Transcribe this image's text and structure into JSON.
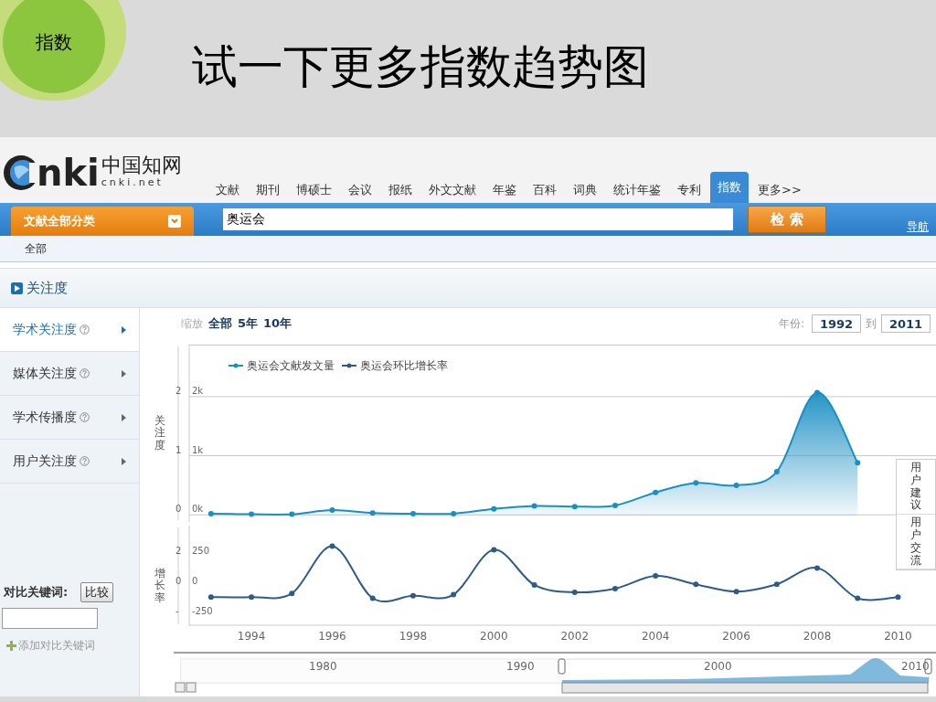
{
  "slide": {
    "badge": "指数",
    "title": "试一下更多指数趋势图"
  },
  "logo": {
    "letters": "nki",
    "chinese": "中国知网",
    "domain": "cnki.net"
  },
  "nav_tabs": [
    {
      "label": "文献",
      "selected": false
    },
    {
      "label": "期刊",
      "selected": false
    },
    {
      "label": "博硕士",
      "selected": false
    },
    {
      "label": "会议",
      "selected": false
    },
    {
      "label": "报纸",
      "selected": false
    },
    {
      "label": "外文文献",
      "selected": false
    },
    {
      "label": "年鉴",
      "selected": false
    },
    {
      "label": "百科",
      "selected": false
    },
    {
      "label": "词典",
      "selected": false
    },
    {
      "label": "统计年鉴",
      "selected": false
    },
    {
      "label": "专利",
      "selected": false
    },
    {
      "label": "指数",
      "selected": true
    },
    {
      "label": "更多>>",
      "selected": false
    }
  ],
  "search": {
    "category": "文献全部分类",
    "value": "奥运会",
    "button": "检 索",
    "nav_link": "导航",
    "scope": "全部"
  },
  "section_title": "关注度",
  "sidebar": {
    "items": [
      {
        "label": "学术关注度",
        "selected": true
      },
      {
        "label": "媒体关注度",
        "selected": false
      },
      {
        "label": "学术传播度",
        "selected": false
      },
      {
        "label": "用户关注度",
        "selected": false
      }
    ],
    "compare_label": "对比关键词:",
    "compare_button": "比较",
    "add_link": "添加对比关键词"
  },
  "toolbar": {
    "zoom_label": "缩放",
    "zoom_options": [
      "全部",
      "5年",
      "10年"
    ],
    "year_label": "年份:",
    "from": "1992",
    "to_label": "到",
    "to": "2011"
  },
  "charts": [
    {
      "marks": [
        "2",
        "1",
        "0"
      ],
      "chart_data": {
        "type": "area",
        "ylabel": "关注度",
        "ylim": [
          -120,
          2880
        ],
        "grid": true,
        "yticks": [
          {
            "value": 2000,
            "label": "2k"
          },
          {
            "value": 1000,
            "label": "1k"
          },
          {
            "value": 0,
            "label": "0k"
          }
        ],
        "series": [
          {
            "name": "奥运会文献发文量",
            "color": "#1a8fc4",
            "marker": true,
            "values": [
              20,
              10,
              10,
              80,
              30,
              20,
              20,
              100,
              150,
              140,
              160,
              380,
              540,
              500,
              730,
              2070,
              880,
              null
            ]
          }
        ]
      }
    },
    {
      "marks": [
        "2",
        "0",
        "-"
      ],
      "chart_data": {
        "type": "line",
        "x": [
          1993,
          1994,
          1995,
          1996,
          1997,
          1998,
          1999,
          2000,
          2001,
          2002,
          2003,
          2004,
          2005,
          2006,
          2007,
          2008,
          2009,
          2010
        ],
        "xlim": [
          1992.46,
          2010.94
        ],
        "ylabel": "增长率",
        "ylim": [
          -370,
          460
        ],
        "yticks": [
          {
            "value": 250,
            "label": "250"
          },
          {
            "value": 0,
            "label": "0"
          },
          {
            "value": -250,
            "label": "-250"
          }
        ],
        "xticks": [
          1994,
          1996,
          1998,
          2000,
          2002,
          2004,
          2006,
          2008,
          2010
        ],
        "series": [
          {
            "name": "奥运会环比增长率",
            "color": "#2d5c8a",
            "marker": true,
            "values": [
              -130,
              -130,
              -100,
              290,
              -140,
              -120,
              -110,
              260,
              -30,
              -90,
              -60,
              45,
              -25,
              -85,
              -25,
              110,
              -140,
              -130
            ]
          }
        ]
      }
    }
  ],
  "navigator": {
    "labels": [
      "1980",
      "1990",
      "2000",
      "2010"
    ]
  },
  "side_widget": [
    "用户建议",
    "用户交流"
  ]
}
